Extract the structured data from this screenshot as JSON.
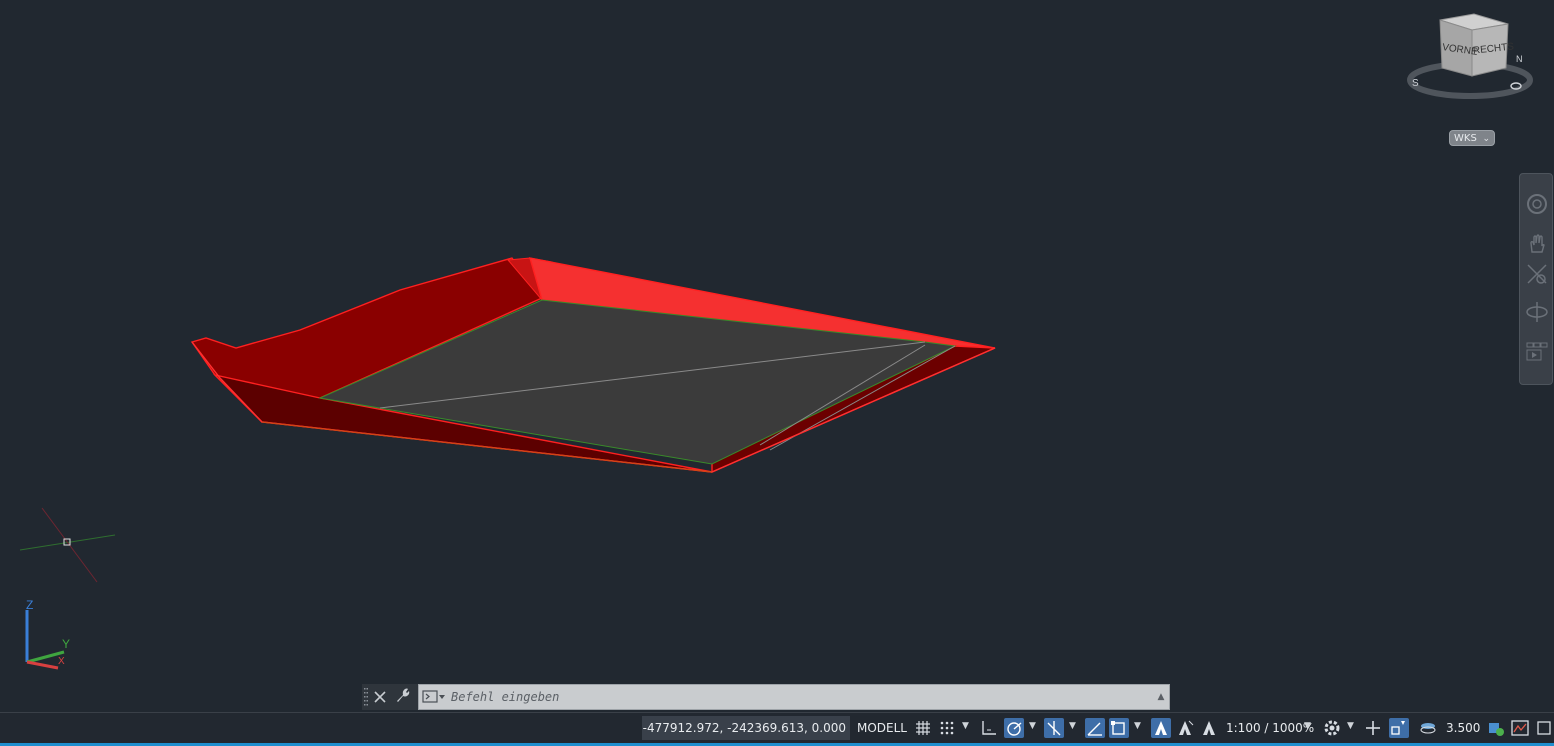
{
  "viewcube": {
    "face_front": "VORNE",
    "face_right": "RECHTS",
    "compass_s": "S",
    "compass_n": "N"
  },
  "ucs_menu": {
    "label": "WKS"
  },
  "ucs_icon": {
    "z_label": "Z",
    "y_label": "Y",
    "x_label": "X"
  },
  "command_line": {
    "placeholder": "Befehl eingeben"
  },
  "status_bar": {
    "coordinates": "-477912.972, -242369.613, 0.000",
    "model_tab": "MODELL",
    "annotation_scale": "1:100 / 1000%",
    "annotation_value": "3.500"
  },
  "colors": {
    "background": "#212830",
    "solid_red": "#ff2020",
    "solid_dark_red": "#7a0000",
    "floor_gray": "#3b3b3b",
    "active_toggle": "#3e6ea8"
  }
}
